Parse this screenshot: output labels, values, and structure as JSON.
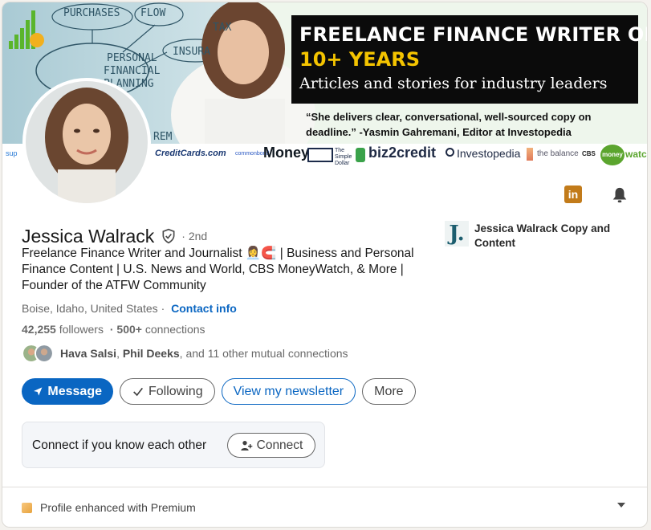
{
  "banner": {
    "title_line1": "FREELANCE FINANCE WRITER OF",
    "title_line2": "10+ YEARS",
    "title_line3": "Articles and stories for industry leaders",
    "quote": "“She delivers clear, conversational, well-sourced copy on deadline.” -Yasmin Gahremani, Editor at Investopedia",
    "scribbles": [
      "PURCHASES",
      "FLOW",
      "TAX",
      "INSURA",
      "PERSONAL",
      "FINANCIAL",
      "PLANNING",
      "REM"
    ],
    "logos": [
      "sup",
      "CreditCards.com",
      "commonbond",
      "Money",
      "The Simple Dollar",
      "biz2credit",
      "Investopedia",
      "the balance",
      "CBS",
      "money",
      "watch"
    ]
  },
  "profile": {
    "name": "Jessica Walrack",
    "degree": "· 2nd",
    "headline": "Freelance Finance Writer and Journalist 👩‍💼🧲 | Business and Personal Finance Content | U.S. News and World, CBS MoneyWatch, & More | Founder of the ATFW Community",
    "location": "Boise, Idaho, United States",
    "location_separator": "·",
    "contact_info": "Contact info",
    "followers_count": "42,255",
    "followers_label": "followers",
    "connections_count": "· 500+",
    "connections_label": "connections",
    "mutual_name1": "Hava Salsi",
    "mutual_separator": ",",
    "mutual_name2": "Phil Deeks",
    "mutual_rest": ", and 11 other mutual connections"
  },
  "actions": {
    "message": "Message",
    "following": "Following",
    "newsletter": "View my newsletter",
    "more": "More"
  },
  "connect_box": {
    "text": "Connect if you know each other",
    "button": "Connect"
  },
  "company": {
    "logo_letter": "J.",
    "name": "Jessica Walrack Copy and Content"
  },
  "premium": {
    "label": "Profile enhanced with Premium"
  },
  "colors": {
    "primary_blue": "#0a66c2",
    "banner_yellow": "#f4c400",
    "banner_black": "#0b0b0b",
    "linkedin_icon": "#c27b1a",
    "premium_gold": "#e7a33e"
  },
  "icons": {
    "linkedin": "linkedin-icon",
    "bell": "bell-icon",
    "verified": "verified-shield-icon",
    "send": "send-icon",
    "check": "check-icon",
    "connect": "add-person-icon",
    "premium": "premium-icon",
    "chevron": "chevron-down-icon"
  }
}
